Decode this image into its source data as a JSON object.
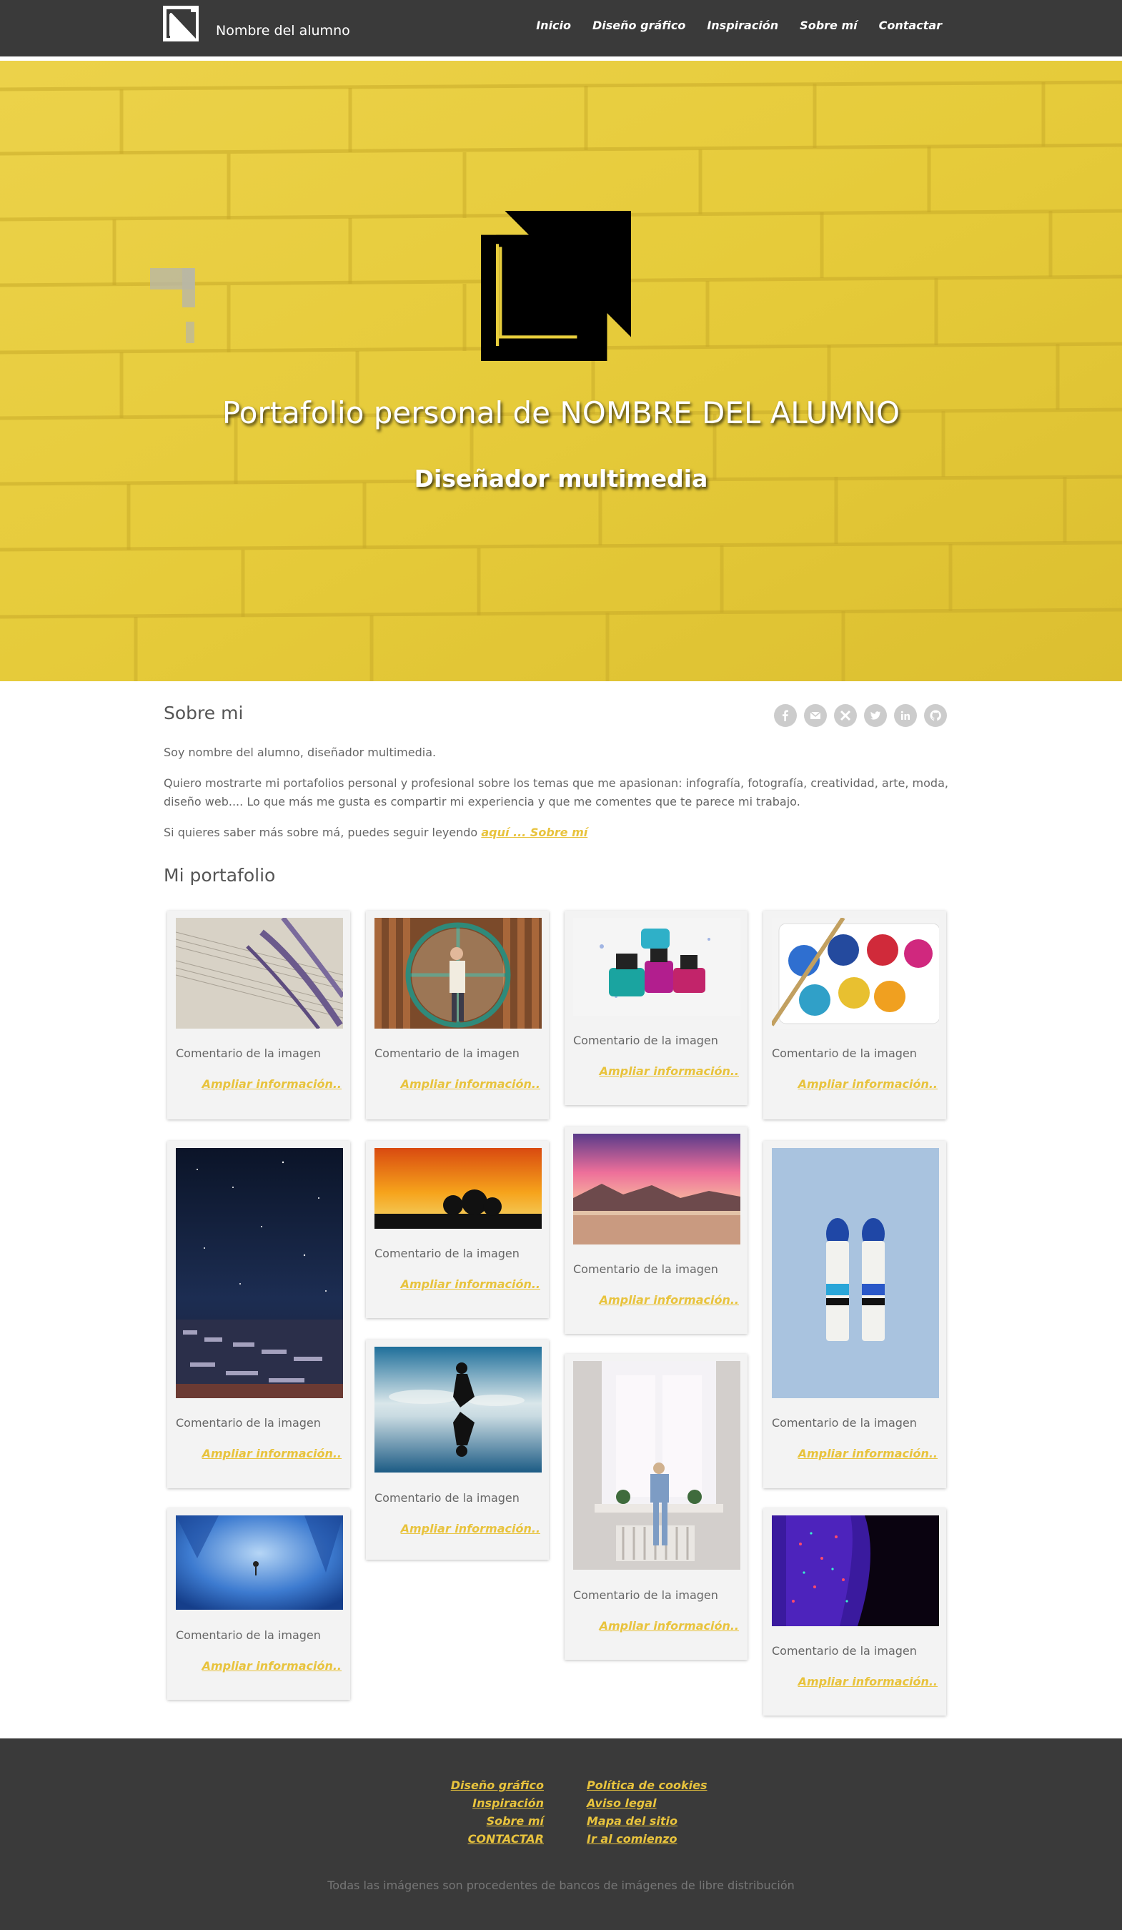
{
  "navbar": {
    "brand_name": "Nombre del alumno",
    "items": [
      {
        "label": "Inicio"
      },
      {
        "label": "Diseño gráfico"
      },
      {
        "label": "Inspiración"
      },
      {
        "label": "Sobre mí"
      },
      {
        "label": "Contactar"
      }
    ]
  },
  "hero": {
    "title": "Portafolio personal de NOMBRE DEL ALUMNO",
    "subtitle": "Diseñador multimedia"
  },
  "about": {
    "title": "Sobre mi",
    "paragraph1": "Soy nombre del alumno, diseñador multimedia.",
    "paragraph2": "Quiero mostrarte mi portafolios personal y profesional sobre los temas que me apasionan: infografía, fotografía, creatividad, arte, moda, diseño web.... Lo que más me gusta es compartir mi experiencia y que me comentes que te parece mi trabajo.",
    "paragraph3_prefix": "Si quieres saber más sobre má, puedes seguir leyendo ",
    "paragraph3_link": "aquí ... Sobre mí",
    "social_icons": [
      "facebook-icon",
      "email-icon",
      "tool-icon",
      "twitter-icon",
      "linkedin-icon",
      "github-icon"
    ]
  },
  "portfolio": {
    "title": "Mi portafolio",
    "caption": "Comentario de la imagen",
    "more_label": "Ampliar información..",
    "items": [
      {
        "image": "lavender-sheet-music-photo",
        "caption": "Comentario de la imagen",
        "more": "Ampliar información.."
      },
      {
        "image": "woman-wheel-window-photo",
        "caption": "Comentario de la imagen",
        "more": "Ampliar información.."
      },
      {
        "image": "nail-polish-bottles-photo",
        "caption": "Comentario de la imagen",
        "more": "Ampliar información.."
      },
      {
        "image": "watercolor-palette-photo",
        "caption": "Comentario de la imagen",
        "more": "Ampliar información.."
      },
      {
        "image": "starry-night-town-photo",
        "caption": "Comentario de la imagen",
        "more": "Ampliar información.."
      },
      {
        "image": "orange-sunset-trees-photo",
        "caption": "Comentario de la imagen",
        "more": "Ampliar información.."
      },
      {
        "image": "pink-sky-beach-photo",
        "caption": "Comentario de la imagen",
        "more": "Ampliar información.."
      },
      {
        "image": "paint-tubes-blue-photo",
        "caption": "Comentario de la imagen",
        "more": "Ampliar información.."
      },
      {
        "image": "silhouette-reflection-photo",
        "caption": "Comentario de la imagen",
        "more": "Ampliar información.."
      },
      {
        "image": "woman-window-sill-photo",
        "caption": "Comentario de la imagen",
        "more": "Ampliar información.."
      },
      {
        "image": "blue-ice-cave-photo",
        "caption": "Comentario de la imagen",
        "more": "Ampliar información.."
      },
      {
        "image": "neon-glitter-face-photo",
        "caption": "Comentario de la imagen",
        "more": "Ampliar información.."
      }
    ]
  },
  "footer": {
    "left_links": [
      "Diseño gráfico",
      "Inspiración",
      "Sobre mí",
      "CONTACTAR"
    ],
    "right_links": [
      "Política de cookies",
      "Aviso legal",
      "Mapa del sitio",
      "Ir al comienzo"
    ],
    "note": "Todas las imágenes son procedentes de bancos de imágenes de libre distribución"
  },
  "colors": {
    "dark": "#3a3a3a",
    "accent": "#e8c33d",
    "hero_yellow": "#e7cd3c",
    "card_bg": "#f3f3f3"
  }
}
